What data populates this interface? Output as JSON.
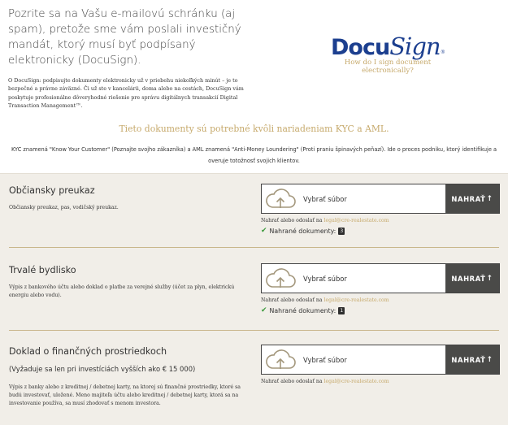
{
  "intro": {
    "heading": "Pozrite sa na Vašu e-mailovú schránku (aj spam), pretože sme vám poslali investičný mandát, ktorý musí byť podpísaný elektronicky (DocuSign).",
    "text": "O DocuSign: podpisujte dokumenty elektronicky už v priebehu niekoľkých minút – je to bezpečné a právne záväzné. Či už ste v kancelárii, doma alebo na cestách, DocuSign vám poskytuje profesionálne dôveryhodné riešenie pre správu digitálnych transakcií Digital Transaction Management™."
  },
  "logo": {
    "part1": "Docu",
    "part2": "Sign",
    "reg": "®",
    "link": "How do I sign document electronically?"
  },
  "kyc": {
    "title": "Tieto dokumenty sú potrebné kvôli nariadeniam KYC a AML.",
    "text": "KYC znamená \"Know Your Customer\" (Poznajte svojho zákazníka) a AML znamená \"Anti-Money Loundering\" (Proti praniu špinavých peňazí). Ide o proces podniku, ktorý identifikuje a overuje totožnosť svojich klientov."
  },
  "upload_labels": {
    "select": "Vybrať súbor",
    "button": "NAHRAŤ",
    "hint_prefix": "Nahrať alebo odoslať na",
    "email": "legal@cre-realestate.com",
    "uploaded_label": "Nahrané dokumenty:"
  },
  "sections": [
    {
      "title": "Občiansky preukaz",
      "subtitle": "",
      "desc": "Občiansky preukaz, pas, vodičský preukaz.",
      "count": "3"
    },
    {
      "title": "Trvalé bydlisko",
      "subtitle": "",
      "desc": "Výpis z bankového účtu alebo doklad o platbe za verejné služby (účet za plyn, elektrickú energiu alebo vodu).",
      "count": "1"
    },
    {
      "title": "Doklad o finančných prostriedkoch",
      "subtitle": "(Vyžaduje sa len pri investíciách vyšších ako € 15 000)",
      "desc": "Výpis z banky alebo z kreditnej / debetnej karty, na ktorej sú finančné prostriedky, ktoré sa budú investovať, uložené. Meno majiteľa účtu alebo kreditnej / debetnej karty, ktorá sa na investovanie používa, sa musí zhodovať s menom investora.",
      "count": ""
    }
  ],
  "colors": {
    "accent": "#c6a96b",
    "brand": "#1c3f8f",
    "panel": "#f1eee8",
    "button": "#4a4a48",
    "check": "#3c9a3c"
  }
}
